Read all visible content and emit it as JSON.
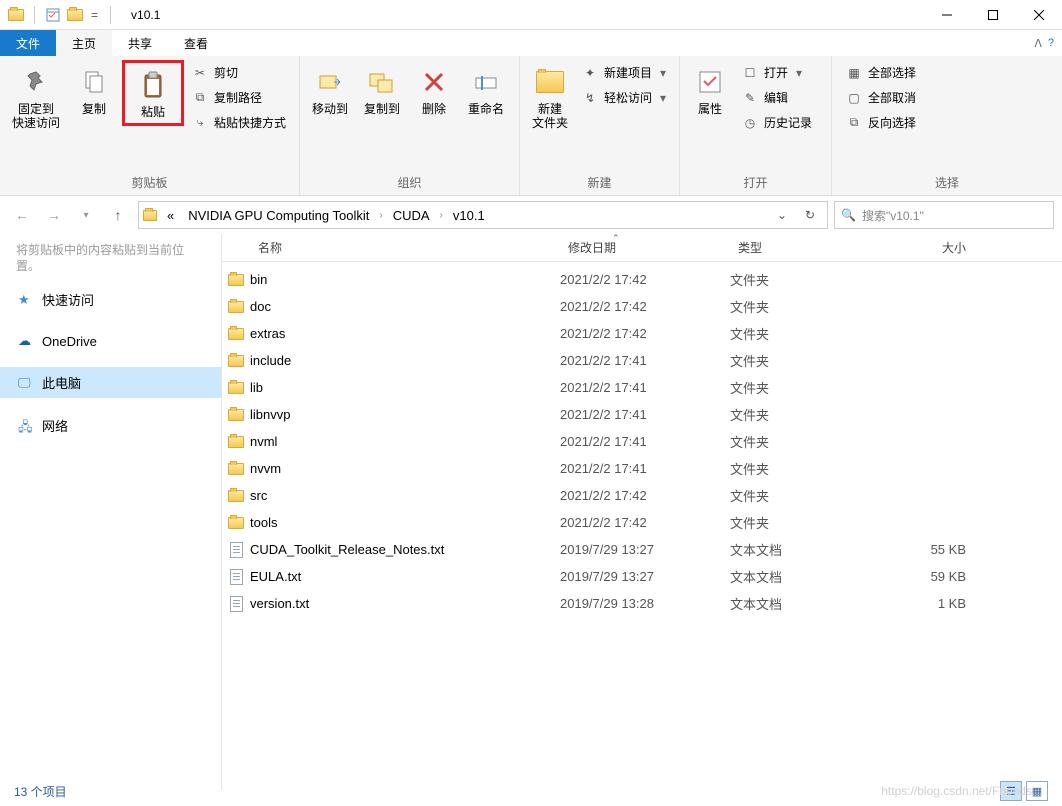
{
  "window": {
    "title": "v10.1"
  },
  "menu": {
    "file": "文件",
    "home": "主页",
    "share": "共享",
    "view": "查看"
  },
  "ribbon": {
    "clipboard": {
      "pin": "固定到\n快速访问",
      "copy": "复制",
      "paste": "粘贴",
      "cut": "剪切",
      "copy_path": "复制路径",
      "paste_shortcut": "粘贴快捷方式",
      "group": "剪贴板"
    },
    "organize": {
      "move_to": "移动到",
      "copy_to": "复制到",
      "delete": "删除",
      "rename": "重命名",
      "group": "组织"
    },
    "new": {
      "new_folder": "新建\n文件夹",
      "new_item": "新建项目",
      "easy_access": "轻松访问",
      "group": "新建"
    },
    "open": {
      "properties": "属性",
      "open": "打开",
      "edit": "编辑",
      "history": "历史记录",
      "group": "打开"
    },
    "select": {
      "select_all": "全部选择",
      "select_none": "全部取消",
      "invert": "反向选择",
      "group": "选择"
    }
  },
  "tooltip_remnant": "将剪贴板中的内容粘贴到当前位置。",
  "breadcrumbs": {
    "root_hint": "«",
    "items": [
      "NVIDIA GPU Computing Toolkit",
      "CUDA",
      "v10.1"
    ]
  },
  "search": {
    "placeholder": "搜索\"v10.1\""
  },
  "nav_pane": {
    "quick_access": "快速访问",
    "onedrive": "OneDrive",
    "this_pc": "此电脑",
    "network": "网络"
  },
  "columns": {
    "name": "名称",
    "date": "修改日期",
    "type": "类型",
    "size": "大小"
  },
  "files": [
    {
      "name": "bin",
      "date": "2021/2/2 17:42",
      "type": "文件夹",
      "size": "",
      "kind": "folder"
    },
    {
      "name": "doc",
      "date": "2021/2/2 17:42",
      "type": "文件夹",
      "size": "",
      "kind": "folder"
    },
    {
      "name": "extras",
      "date": "2021/2/2 17:42",
      "type": "文件夹",
      "size": "",
      "kind": "folder"
    },
    {
      "name": "include",
      "date": "2021/2/2 17:41",
      "type": "文件夹",
      "size": "",
      "kind": "folder"
    },
    {
      "name": "lib",
      "date": "2021/2/2 17:41",
      "type": "文件夹",
      "size": "",
      "kind": "folder"
    },
    {
      "name": "libnvvp",
      "date": "2021/2/2 17:41",
      "type": "文件夹",
      "size": "",
      "kind": "folder"
    },
    {
      "name": "nvml",
      "date": "2021/2/2 17:41",
      "type": "文件夹",
      "size": "",
      "kind": "folder"
    },
    {
      "name": "nvvm",
      "date": "2021/2/2 17:41",
      "type": "文件夹",
      "size": "",
      "kind": "folder"
    },
    {
      "name": "src",
      "date": "2021/2/2 17:42",
      "type": "文件夹",
      "size": "",
      "kind": "folder"
    },
    {
      "name": "tools",
      "date": "2021/2/2 17:42",
      "type": "文件夹",
      "size": "",
      "kind": "folder"
    },
    {
      "name": "CUDA_Toolkit_Release_Notes.txt",
      "date": "2019/7/29 13:27",
      "type": "文本文档",
      "size": "55 KB",
      "kind": "text"
    },
    {
      "name": "EULA.txt",
      "date": "2019/7/29 13:27",
      "type": "文本文档",
      "size": "59 KB",
      "kind": "text"
    },
    {
      "name": "version.txt",
      "date": "2019/7/29 13:28",
      "type": "文本文档",
      "size": "1 KB",
      "kind": "text"
    }
  ],
  "status": {
    "text": "13 个项目"
  },
  "watermark": "https://blog.csdn.net/Friends..."
}
